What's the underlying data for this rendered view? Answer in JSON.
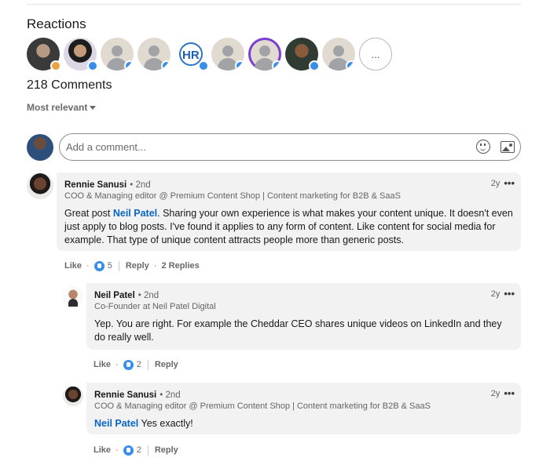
{
  "reactions": {
    "title": "Reactions",
    "more_label": "..."
  },
  "comments_header": {
    "count_text": "218 Comments",
    "sort_label": "Most relevant"
  },
  "composer": {
    "placeholder": "Add a comment..."
  },
  "comments": [
    {
      "name": "Rennie Sanusi",
      "degree": "• 2nd",
      "headline": "COO & Managing editor @ Premium Content Shop | Content marketing for B2B & SaaS",
      "time": "2y",
      "more": "•••",
      "mention": "Neil Patel",
      "text_before": "Great post ",
      "text_after": ". Sharing your own experience is what makes your content unique. It doesn't even just apply to blog posts. I've found it applies to any form of content. Like content for social media for example. That type of unique content attracts people more than generic posts.",
      "actions": {
        "like": "Like",
        "dot": "·",
        "like_count": "5",
        "reply": "Reply",
        "replies": "2 Replies"
      }
    },
    {
      "name": "Neil Patel",
      "degree": "• 2nd",
      "headline": "Co-Founder at Neil Patel Digital",
      "time": "2y",
      "more": "•••",
      "text": "Yep. You are right. For example the Cheddar CEO shares unique videos on LinkedIn and they do really well.",
      "actions": {
        "like": "Like",
        "dot": "·",
        "like_count": "2",
        "reply": "Reply"
      }
    },
    {
      "name": "Rennie Sanusi",
      "degree": "• 2nd",
      "headline": "COO & Managing editor @ Premium Content Shop | Content marketing for B2B & SaaS",
      "time": "2y",
      "more": "•••",
      "mention": "Neil Patel",
      "text_after": " Yes exactly!",
      "actions": {
        "like": "Like",
        "dot": "·",
        "like_count": "2",
        "reply": "Reply"
      }
    }
  ],
  "colors": {
    "link_blue": "#0a66c2",
    "like_blue": "#378fe9",
    "bubble_bg": "#f2f2f2"
  }
}
